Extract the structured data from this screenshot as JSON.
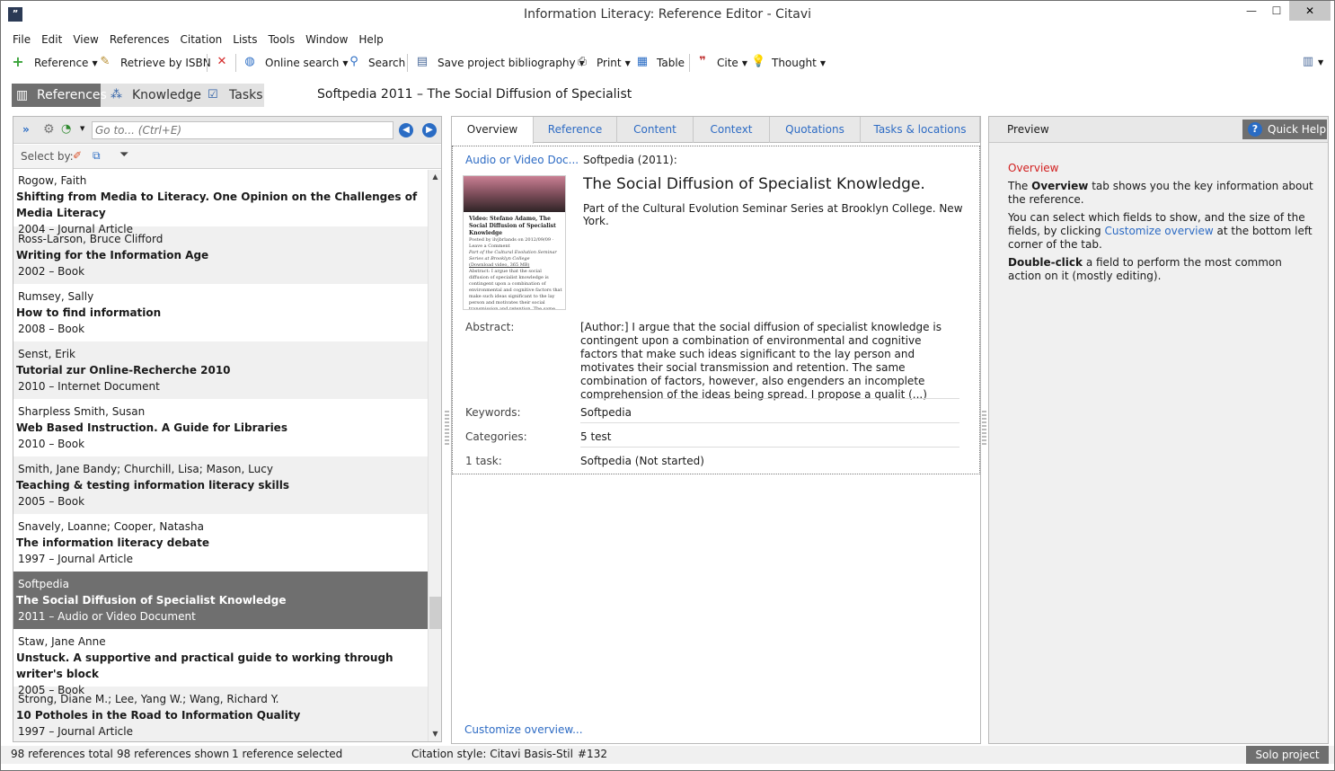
{
  "window": {
    "title": "Information Literacy: Reference Editor - Citavi",
    "controls": {
      "minimize": "—",
      "maximize": "☐",
      "close": "✕"
    }
  },
  "menu": [
    "File",
    "Edit",
    "View",
    "References",
    "Citation",
    "Lists",
    "Tools",
    "Window",
    "Help"
  ],
  "toolbar": {
    "reference": "Reference",
    "retrieve_isbn": "Retrieve by ISBN",
    "online_search": "Online search",
    "search": "Search",
    "save_bibliography": "Save project bibliography",
    "print": "Print",
    "table": "Table",
    "cite": "Cite",
    "thought": "Thought"
  },
  "nav": {
    "references": "References",
    "knowledge": "Knowledge",
    "tasks": "Tasks"
  },
  "current_reference_heading": "Softpedia 2011 – The Social Diffusion of Specialist",
  "left": {
    "goto_placeholder": "Go to... (Ctrl+E)",
    "select_by": "Select by:",
    "references": [
      {
        "author": "Rogow, Faith",
        "title": "Shifting from Media to Literacy. One Opinion on the Challenges of Media Literacy",
        "year_type": "2004 – Journal Article"
      },
      {
        "author": "Ross-Larson, Bruce Clifford",
        "title": "Writing for the Information Age",
        "year_type": "2002 – Book"
      },
      {
        "author": "Rumsey, Sally",
        "title": "How to find information",
        "year_type": "2008 – Book"
      },
      {
        "author": "Senst, Erik",
        "title": "Tutorial zur Online-Recherche 2010",
        "year_type": "2010 – Internet Document"
      },
      {
        "author": "Sharpless Smith, Susan",
        "title": "Web Based Instruction. A Guide for Libraries",
        "year_type": "2010 – Book"
      },
      {
        "author": "Smith, Jane Bandy; Churchill, Lisa; Mason, Lucy",
        "title": "Teaching & testing information literacy skills",
        "year_type": "2005 – Book"
      },
      {
        "author": "Snavely, Loanne; Cooper, Natasha",
        "title": "The information literacy debate",
        "year_type": "1997 – Journal Article"
      },
      {
        "author": "Softpedia",
        "title": "The Social Diffusion of Specialist Knowledge",
        "year_type": "2011 – Audio or Video Document"
      },
      {
        "author": "Staw, Jane Anne",
        "title": "Unstuck. A supportive and practical guide to working through writer's block",
        "year_type": "2005 – Book"
      },
      {
        "author": "Strong, Diane M.; Lee, Yang W.; Wang, Richard Y.",
        "title": "10 Potholes in the Road to Information Quality",
        "year_type": "1997 – Journal Article"
      }
    ],
    "selected_index": 7
  },
  "center": {
    "tabs": [
      "Overview",
      "Reference",
      "Content",
      "Context",
      "Quotations",
      "Tasks & locations"
    ],
    "active_tab": "Overview",
    "type_link": "Audio or Video Doc...",
    "citation": "Softpedia (2011):",
    "title": "The Social Diffusion of Specialist Knowledge.",
    "series": "Part of the Cultural Evolution Seminar Series at Brooklyn College. New York.",
    "thumbnail": {
      "heading": "Video: Stefano Adamo, The Social Diffusion of Specialist Knowledge",
      "byline": "Posted by ilvjbrlands on 2012/09/09 · Leave a Comment",
      "series": "Part of the Cultural Evolution Seminar Series at Brooklyn College",
      "download": "(Download video, 365 MB)",
      "abstract": "Abstract: I argue that the social diffusion of specialist knowledge is contingent upon a combination of environmental and cognitive factors that make such ideas significant to the lay person and motivates their social transmission and retention. The same combination of factors, however, also engenders an incomplete comprehension of the ideas being spread. I propose a qualitative method to understand what makes specialist knowledge relevant"
    },
    "fields": {
      "abstract_label": "Abstract:",
      "abstract_value": "[Author:] I argue that the social diffusion of specialist knowledge is contingent upon a combination of environmental and cognitive factors that make such ideas significant to the lay person and motivates their social transmission and retention. The same combination of factors, however, also engenders an incomplete comprehension of the ideas being spread. I propose a qualit (...)",
      "keywords_label": "Keywords:",
      "keywords_value": "Softpedia",
      "categories_label": "Categories:",
      "categories_value": "5 test",
      "task_label": "1 task:",
      "task_value": "Softpedia (Not started)"
    },
    "customize_link": "Customize overview..."
  },
  "right": {
    "preview_label": "Preview",
    "quick_help": "Quick Help",
    "help": {
      "heading": "Overview",
      "p1_a": "The ",
      "p1_b": "Overview",
      "p1_c": " tab shows you the key information about the reference.",
      "p2_a": "You can select which fields to show, and the size of the fields, by clicking ",
      "p2_link": "Customize overview",
      "p2_c": " at the bottom left corner of the tab.",
      "p3_a": "Double-click",
      "p3_b": " a field to perform the most common action on it (mostly editing)."
    }
  },
  "status": {
    "total": "98 references total",
    "shown": "98 references shown",
    "selected": "1 reference selected",
    "citation_style": "Citation style: Citavi Basis-Stil",
    "number": "#132",
    "project": "Solo project"
  },
  "colors": {
    "accent_link": "#2d6bc4",
    "selected_row": "#6f6f6f",
    "help_heading": "#d22020"
  }
}
